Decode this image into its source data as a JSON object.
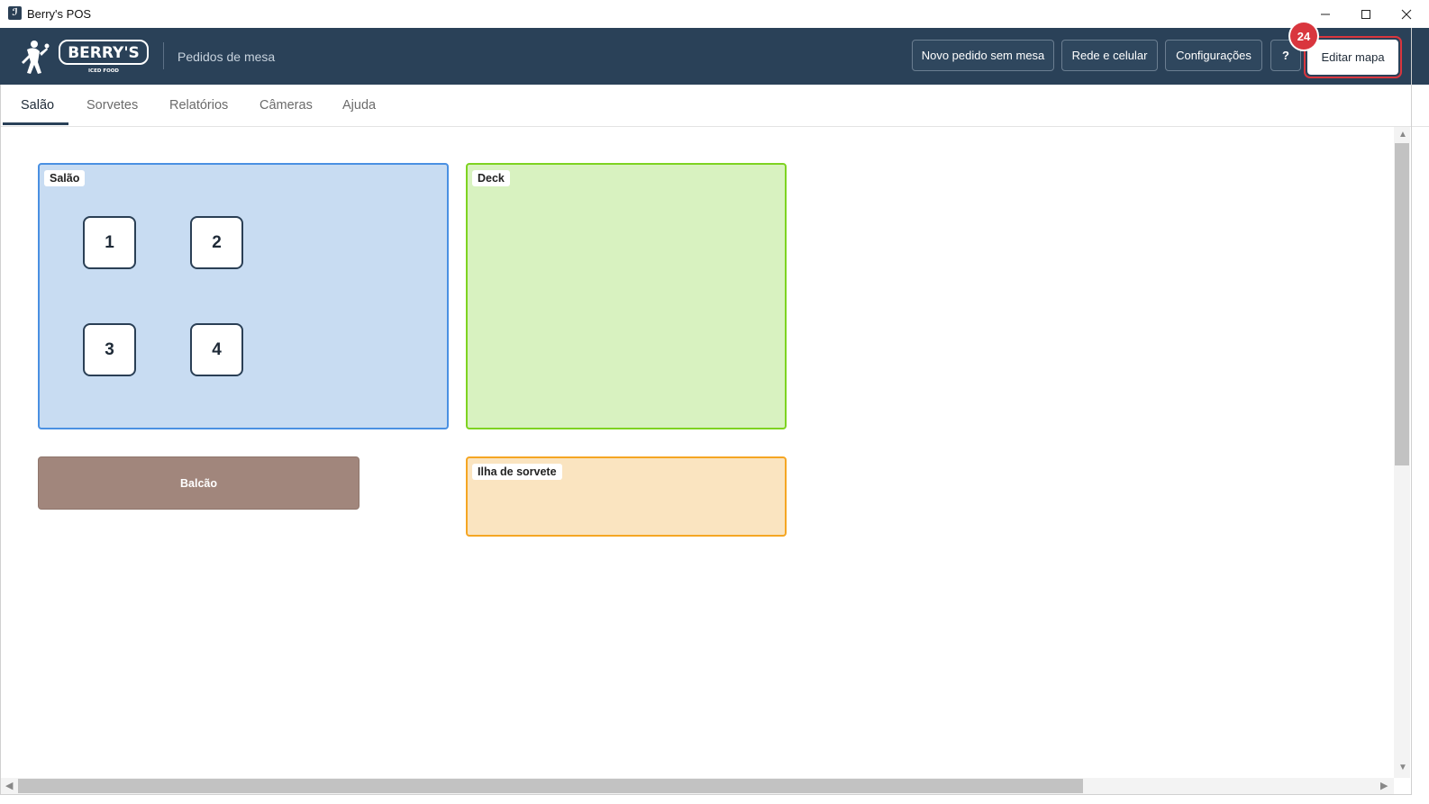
{
  "window": {
    "title": "Berry's POS",
    "icon": "berrys-app-icon",
    "controls": [
      "minimize-icon",
      "maximize-icon",
      "close-icon"
    ]
  },
  "header": {
    "logo_text": "BERRY'S",
    "logo_subtext": "ICED FOOD",
    "subtitle": "Pedidos de mesa",
    "buttons": {
      "new_order": "Novo pedido sem mesa",
      "network": "Rede e celular",
      "settings": "Configurações",
      "help": "?",
      "edit_map": "Editar mapa"
    },
    "badge": "24",
    "colors": {
      "background": "#2a4158",
      "highlight": "#d9363e"
    }
  },
  "tabs": [
    {
      "label": "Salão",
      "active": true
    },
    {
      "label": "Sorvetes",
      "active": false
    },
    {
      "label": "Relatórios",
      "active": false
    },
    {
      "label": "Câmeras",
      "active": false
    },
    {
      "label": "Ajuda",
      "active": false
    }
  ],
  "map": {
    "zones": {
      "salao": {
        "label": "Salão",
        "color": "#c8dcf2",
        "border": "#4a90e2"
      },
      "deck": {
        "label": "Deck",
        "color": "#d8f2c0",
        "border": "#7ed321"
      },
      "balcao": {
        "label": "Balcão",
        "color": "#a1867c"
      },
      "ilha": {
        "label": "Ilha de sorvete",
        "color": "#fae4c0",
        "border": "#f5a623"
      }
    },
    "tables": [
      "1",
      "2",
      "3",
      "4"
    ]
  }
}
